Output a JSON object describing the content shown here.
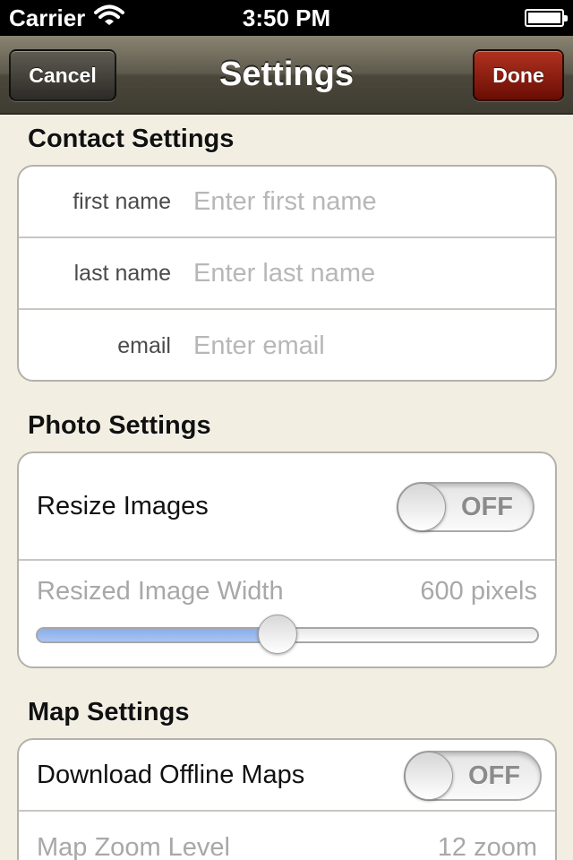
{
  "status_bar": {
    "carrier": "Carrier",
    "wifi_icon": "wifi-icon",
    "time": "3:50 PM",
    "battery_icon": "battery-icon",
    "battery_level": 1.0
  },
  "nav": {
    "title": "Settings",
    "cancel_label": "Cancel",
    "done_label": "Done",
    "cancel_color": "#3a3832",
    "done_color": "#8a1a0c"
  },
  "contact": {
    "header": "Contact Settings",
    "fields": [
      {
        "label": "first name",
        "placeholder": "Enter first name",
        "value": ""
      },
      {
        "label": "last name",
        "placeholder": "Enter last name",
        "value": ""
      },
      {
        "label": "email",
        "placeholder": "Enter email",
        "value": ""
      }
    ]
  },
  "photo": {
    "header": "Photo Settings",
    "resize_label": "Resize Images",
    "resize_toggle": "OFF",
    "width_label": "Resized Image Width",
    "width_value": "600 pixels",
    "width_slider_fraction": 0.48,
    "slider_fill_color": "#a9c4f2"
  },
  "map": {
    "header": "Map Settings",
    "download_label": "Download Offline Maps",
    "download_toggle": "OFF",
    "zoom_label": "Map Zoom Level",
    "zoom_value": "12 zoom"
  }
}
